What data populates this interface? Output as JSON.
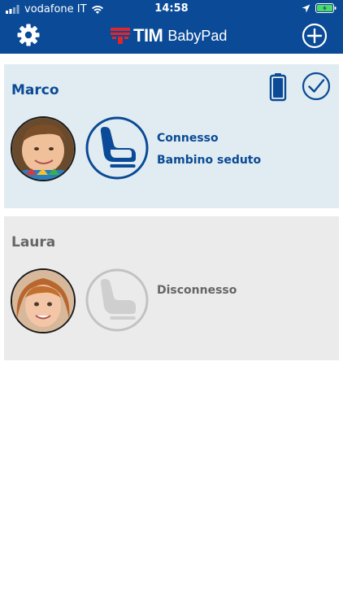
{
  "status_bar": {
    "carrier": "vodafone IT",
    "time": "14:58"
  },
  "header": {
    "brand_tim": "TIM",
    "brand_product": "BabyPad"
  },
  "children": [
    {
      "name": "Marco",
      "status_lines": [
        "Connesso",
        "Bambino seduto"
      ],
      "state": "connected"
    },
    {
      "name": "Laura",
      "status_lines": [
        "Disconnesso"
      ],
      "state": "disconnected"
    }
  ],
  "colors": {
    "brand_blue": "#0a4a96",
    "active_card_bg": "#e0ecf1",
    "inactive_card_bg": "#ebebeb",
    "tim_red": "#e3242b"
  },
  "icons": {
    "settings": "gear-icon",
    "add": "plus-circle-icon",
    "battery": "battery-icon",
    "check": "check-circle-icon",
    "seat": "car-seat-icon"
  }
}
